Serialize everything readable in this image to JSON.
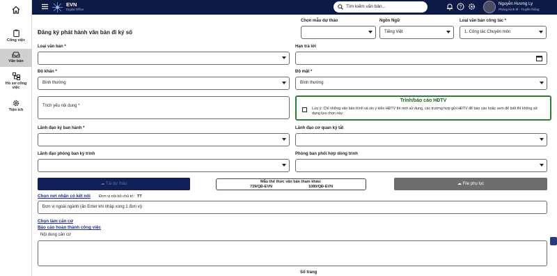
{
  "rail": {
    "home_icon": "home-icon",
    "items": [
      {
        "label": "Công việc",
        "icon": "clipboard-icon"
      },
      {
        "label": "Văn bản",
        "icon": "inbox-icon"
      },
      {
        "label": "Hồ sơ công việc",
        "icon": "hierarchy-icon"
      },
      {
        "label": "Tiện ích",
        "icon": "gear-icon"
      }
    ]
  },
  "topbar": {
    "app_name": "EVN",
    "app_sub": "Digital Office",
    "search_placeholder": "Tìm kiếm văn bản...",
    "user_name": "Nguyễn Hương Ly",
    "user_role": "Phòng Kinh tế - Truyền thông"
  },
  "page_title": "Đăng ký phát hành văn bản đi ký số",
  "top_selects": {
    "template_label": "Chọn mẫu dự thảo",
    "template_value": "",
    "language_label": "Ngôn Ngữ",
    "language_value": "Tiếng Việt",
    "doc_kind_label": "Loại văn bản công tác *",
    "doc_kind_value": "1. Công tác Chuyên môn"
  },
  "form": {
    "doc_type_label": "Loại văn bản *",
    "doc_type_value": "",
    "deadline_label": "Hạn trả lời",
    "deadline_value": "",
    "urgency_label": "Độ khẩn *",
    "urgency_value": "Bình thường",
    "secrecy_label": "Độ mật *",
    "secrecy_value": "Bình thường",
    "summary_placeholder": "Trích yếu nội dung *",
    "hdtv_title": "Trình/báo cáo HĐTV",
    "hdtv_note": "Lưu ý: Chỉ những văn bản trình và xin ý kiến HĐTV thì mới sử dụng, các trường hợp gửi HĐTV để báo cáo hoặc xem để biết thì không sử dụng lựa chọn này.",
    "issuer_label": "Lãnh đạo ký ban hành *",
    "issuer_value": "",
    "agency_leader_label": "Lãnh đạo cơ quan ký tắt",
    "agency_leader_value": "",
    "dept_leader_label": "Lãnh đạo phòng ban ký trình",
    "dept_leader_value": "",
    "coordinate_label": "Phòng ban phối hợp dòng trình",
    "coordinate_value": ""
  },
  "actions": {
    "upload_label": "Tải dự thảo",
    "reference_title": "Mẫu thể thức văn bản tham khảo:",
    "reference_a": "739/QĐ-EVN",
    "reference_b": "1080/QĐ-EVN",
    "attach_label": "File phụ lục"
  },
  "recipients": {
    "link_choose": "Chọn nơi nhận có kết nối",
    "internal_unit_label": "Đơn vị nội bộ chủ trì:",
    "internal_unit_value": "TT",
    "external_placeholder": "Đơn vị ngoài ngành (ấn Enter khi nhập xong 1 đơn vị)",
    "link_basis": "Chọn làm căn cứ",
    "link_report": "Báo cáo hoàn thành công việc",
    "basis_label": "Nội dung căn cứ",
    "pages_label": "Số trang"
  },
  "colors": {
    "topbar": "#0e1a46",
    "upload_button": "#12205a",
    "attach_button": "#6e6e6e",
    "hdtv_border": "#2e7d32"
  }
}
